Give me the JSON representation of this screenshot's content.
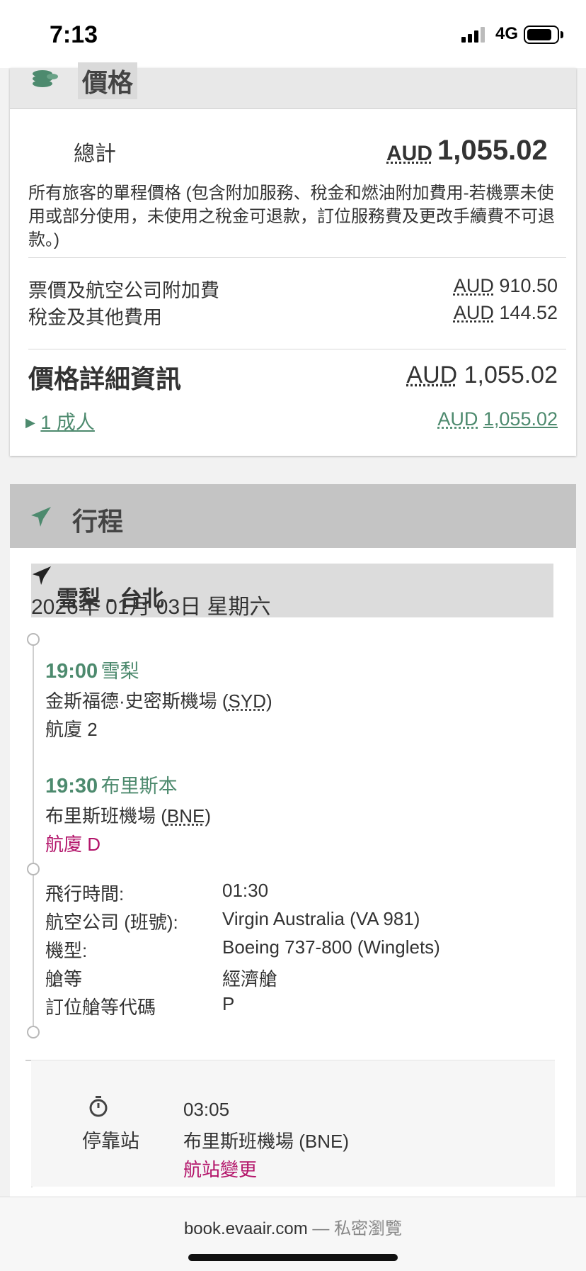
{
  "status_bar": {
    "time": "7:13",
    "network": "4G"
  },
  "price": {
    "title": "價格",
    "total_label": "總計",
    "total_currency": "AUD",
    "total_amount": "1,055.02",
    "description": "所有旅客的單程價格 (包含附加服務、稅金和燃油附加費用-若機票未使用或部分使用，未使用之稅金可退款，訂位服務費及更改手續費不可退款。)",
    "rows": [
      {
        "label": "票價及航空公司附加費",
        "currency": "AUD",
        "amount": "910.50"
      },
      {
        "label": "稅金及其他費用",
        "currency": "AUD",
        "amount": "144.52"
      }
    ],
    "detail_title": "價格詳細資訊",
    "detail_currency": "AUD",
    "detail_amount": "1,055.02",
    "passenger_link": "1 成人",
    "passenger_currency": "AUD",
    "passenger_amount": "1,055.02"
  },
  "itinerary": {
    "title": "行程",
    "route": "雪梨 - 台北",
    "date": "2026年 01月 03日 星期六",
    "departure": {
      "time": "19:00",
      "city": "雪梨",
      "airport_name": "金斯福德·史密斯機場 (",
      "airport_code": "SYD",
      "terminal": "航廈 2"
    },
    "arrival": {
      "time": "19:30",
      "city": "布里斯本",
      "airport_name": "布里斯班機場 (",
      "airport_code": "BNE",
      "terminal": "航廈 D"
    },
    "details": [
      {
        "key": "飛行時間:",
        "value": "01:30"
      },
      {
        "key": "航空公司 (班號):",
        "value": "Virgin Australia (VA 981)"
      },
      {
        "key": "機型:",
        "value": "Boeing 737-800 (Winglets)"
      },
      {
        "key": "艙等",
        "value": "經濟艙"
      },
      {
        "key": "訂位艙等代碼",
        "value": "P"
      }
    ],
    "stopover": {
      "label": "停靠站",
      "duration": "03:05",
      "airport": "布里斯班機場 (BNE)",
      "note": "航站變更"
    }
  },
  "browser": {
    "domain": "book.evaair.com",
    "separator": " — ",
    "mode": "私密瀏覽"
  },
  "colors": {
    "accent_green": "#4d8a6e",
    "magenta": "#b3146a",
    "header_grey": "#c4c4c4"
  },
  "icons": [
    "coins-icon",
    "plane-icon",
    "stopwatch-icon",
    "chevron-right-icon"
  ]
}
